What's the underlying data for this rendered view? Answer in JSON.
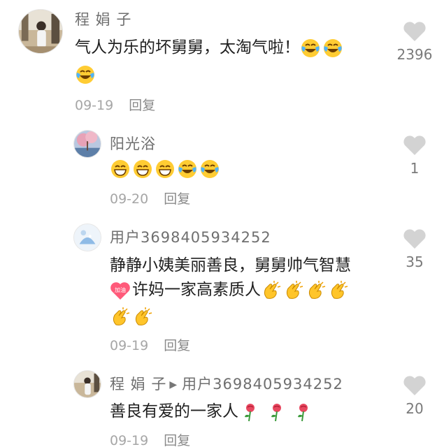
{
  "comments": [
    {
      "user": "程 娟 子",
      "text_line1": "气人为乐的坏舅舅，太淘气啦！",
      "date": "09-19",
      "reply_label": "回复",
      "likes": "2396"
    },
    {
      "user": "阳光浴",
      "date": "09-20",
      "reply_label": "回复",
      "likes": "1"
    },
    {
      "user": "用户3698405934252",
      "text_line1": "静静小姨美丽善良，舅舅帅气智慧",
      "text_line2": "许妈一家高素质人",
      "badge_text": "加油",
      "date": "09-19",
      "reply_label": "回复",
      "likes": "35"
    },
    {
      "user": "程 娟 子",
      "reply_to": "用户3698405934252",
      "text_line1": "善良有爱的一家人",
      "date": "09-19",
      "reply_label": "回复",
      "likes": "20"
    }
  ],
  "icons": {
    "heart": "heart-icon",
    "laugh_cry": "laughing-tears-emoji",
    "grin": "grinning-emoji",
    "clap": "clapping-hands-emoji",
    "rose": "rose-emoji",
    "arrow": "reply-arrow-icon"
  },
  "colors": {
    "heart": "#d3d3d3",
    "muted_text": "#a6a6a6",
    "username": "#6f6f6f"
  }
}
